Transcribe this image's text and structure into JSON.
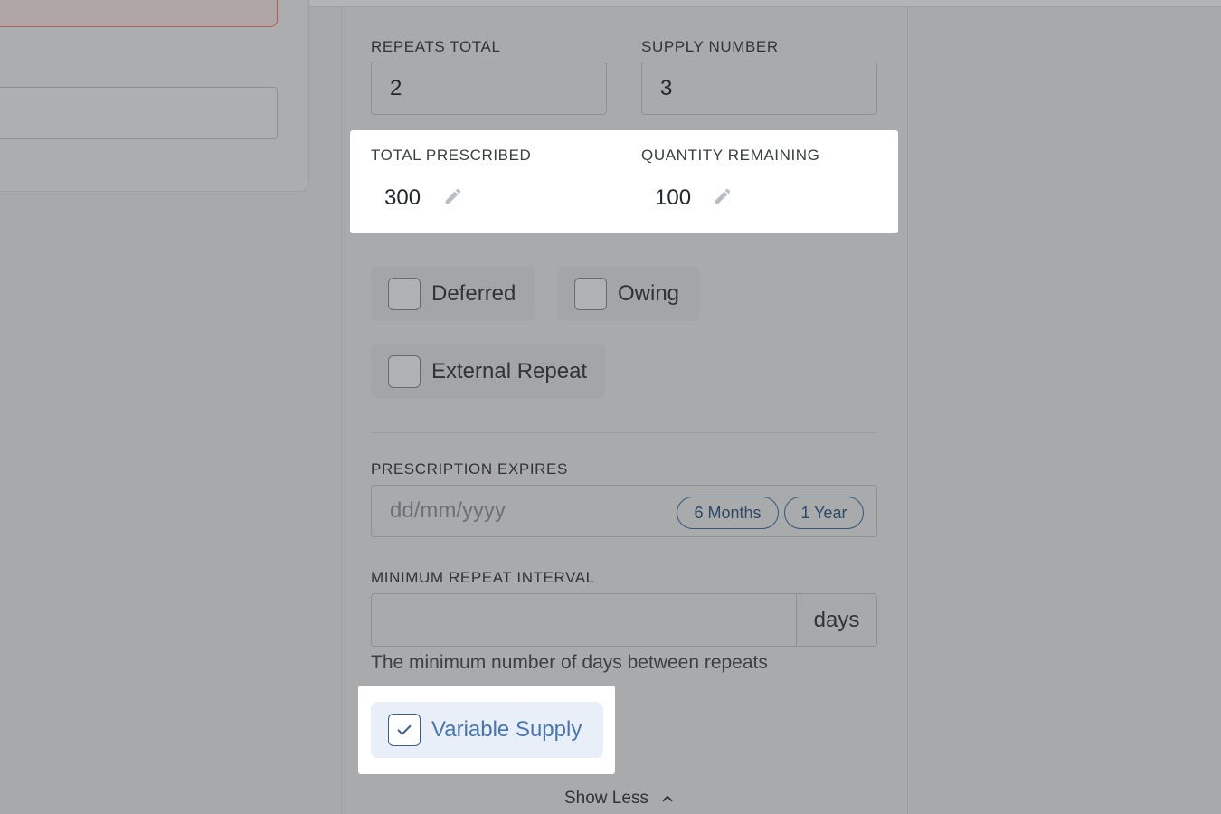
{
  "repeats_total": {
    "label": "REPEATS TOTAL",
    "value": "2"
  },
  "supply_number": {
    "label": "SUPPLY NUMBER",
    "value": "3"
  },
  "total_prescribed": {
    "label": "TOTAL PRESCRIBED",
    "value": "300",
    "edit_icon": "pencil-icon"
  },
  "quantity_remaining": {
    "label": "QUANTITY REMAINING",
    "value": "100",
    "edit_icon": "pencil-icon"
  },
  "checkboxes": {
    "deferred": {
      "label": "Deferred",
      "checked": false
    },
    "owing": {
      "label": "Owing",
      "checked": false
    },
    "external_repeat": {
      "label": "External Repeat",
      "checked": false
    },
    "variable_supply": {
      "label": "Variable Supply",
      "checked": true
    }
  },
  "prescription_expires": {
    "label": "PRESCRIPTION EXPIRES",
    "placeholder": "dd/mm/yyyy",
    "quick_options": [
      "6 Months",
      "1 Year"
    ]
  },
  "minimum_repeat_interval": {
    "label": "MINIMUM REPEAT INTERVAL",
    "value": "",
    "unit": "days",
    "helper": "The minimum number of days between repeats"
  },
  "show_less": {
    "label": "Show Less",
    "icon": "chevron-up-icon"
  },
  "colors": {
    "overlay": "#a8a9aa",
    "highlight": "#ffffff",
    "accent": "#4a76ad",
    "pill_border": "#355879",
    "checked_chip_bg": "#e8eff9"
  }
}
